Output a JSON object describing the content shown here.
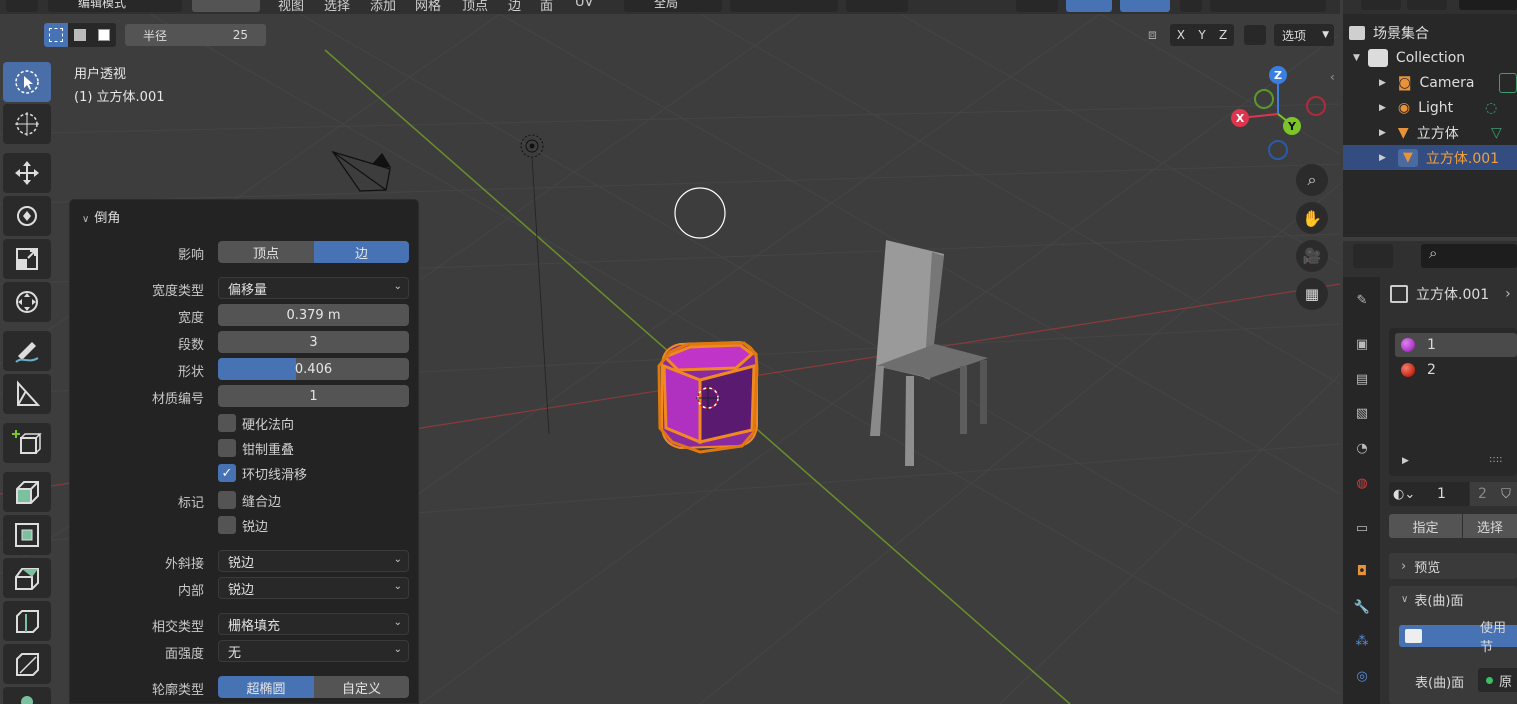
{
  "header": {
    "mode_label": "编辑模式",
    "menus": [
      "视图",
      "选择",
      "添加",
      "网格",
      "顶点",
      "边",
      "面",
      "UV"
    ],
    "transform_orientation": "全局",
    "radius_label": "半径",
    "radius_value": "25",
    "axis_x": "X",
    "axis_y": "Y",
    "axis_z": "Z",
    "options_label": "选项"
  },
  "viewport": {
    "view_name": "用户透视",
    "object_name": "(1) 立方体.001",
    "gizmo": {
      "x": "X",
      "y": "Y",
      "z": "Z"
    }
  },
  "operator_panel": {
    "title": "倒角",
    "affect_label": "影响",
    "affect_options": [
      "顶点",
      "边"
    ],
    "affect_selected": "边",
    "width_type_label": "宽度类型",
    "width_type_value": "偏移量",
    "width_label": "宽度",
    "width_value": "0.379 m",
    "segments_label": "段数",
    "segments_value": "3",
    "shape_label": "形状",
    "shape_value": "0.406",
    "shape_fraction": 0.406,
    "material_label": "材质编号",
    "material_value": "1",
    "harden_normals": {
      "label": "硬化法向",
      "checked": false
    },
    "clamp_overlap": {
      "label": "钳制重叠",
      "checked": false
    },
    "loop_slide": {
      "label": "环切线滑移",
      "checked": true
    },
    "mark_label": "标记",
    "mark_seam": {
      "label": "缝合边",
      "checked": false
    },
    "mark_sharp": {
      "label": "锐边",
      "checked": false
    },
    "miter_outer_label": "外斜接",
    "miter_outer_value": "锐边",
    "miter_inner_label": "内部",
    "miter_inner_value": "锐边",
    "intersection_label": "相交类型",
    "intersection_value": "栅格填充",
    "face_strength_label": "面强度",
    "face_strength_value": "无",
    "profile_type_label": "轮廓类型",
    "profile_options": [
      "超椭圆",
      "自定义"
    ],
    "profile_selected": "超椭圆"
  },
  "outliner": {
    "scene_collection": "场景集合",
    "items": [
      {
        "label": "Collection",
        "icon": "collection-icon"
      },
      {
        "label": "Camera",
        "icon": "camera-icon"
      },
      {
        "label": "Light",
        "icon": "light-icon"
      },
      {
        "label": "立方体",
        "icon": "mesh-icon"
      },
      {
        "label": "立方体.001",
        "icon": "mesh-icon",
        "selected": true
      }
    ]
  },
  "properties": {
    "object_name": "立方体.001",
    "material_slots": [
      {
        "label": "1",
        "color": "#b040c8"
      },
      {
        "label": "2",
        "color": "#d03020"
      }
    ],
    "slot_index": "1",
    "slot_count": "2",
    "assign_label": "指定",
    "select_label": "选择",
    "preview_label": "预览",
    "surface_label": "表(曲)面",
    "use_nodes_label": "使用节",
    "surface_row_label": "表(曲)面",
    "surface_row_value": "原"
  },
  "colors": {
    "accent": "#4772b3",
    "selected_orange": "#f0a040",
    "axis_x": "#e0334d",
    "axis_y": "#7cc528",
    "axis_z": "#3a7ee0"
  }
}
